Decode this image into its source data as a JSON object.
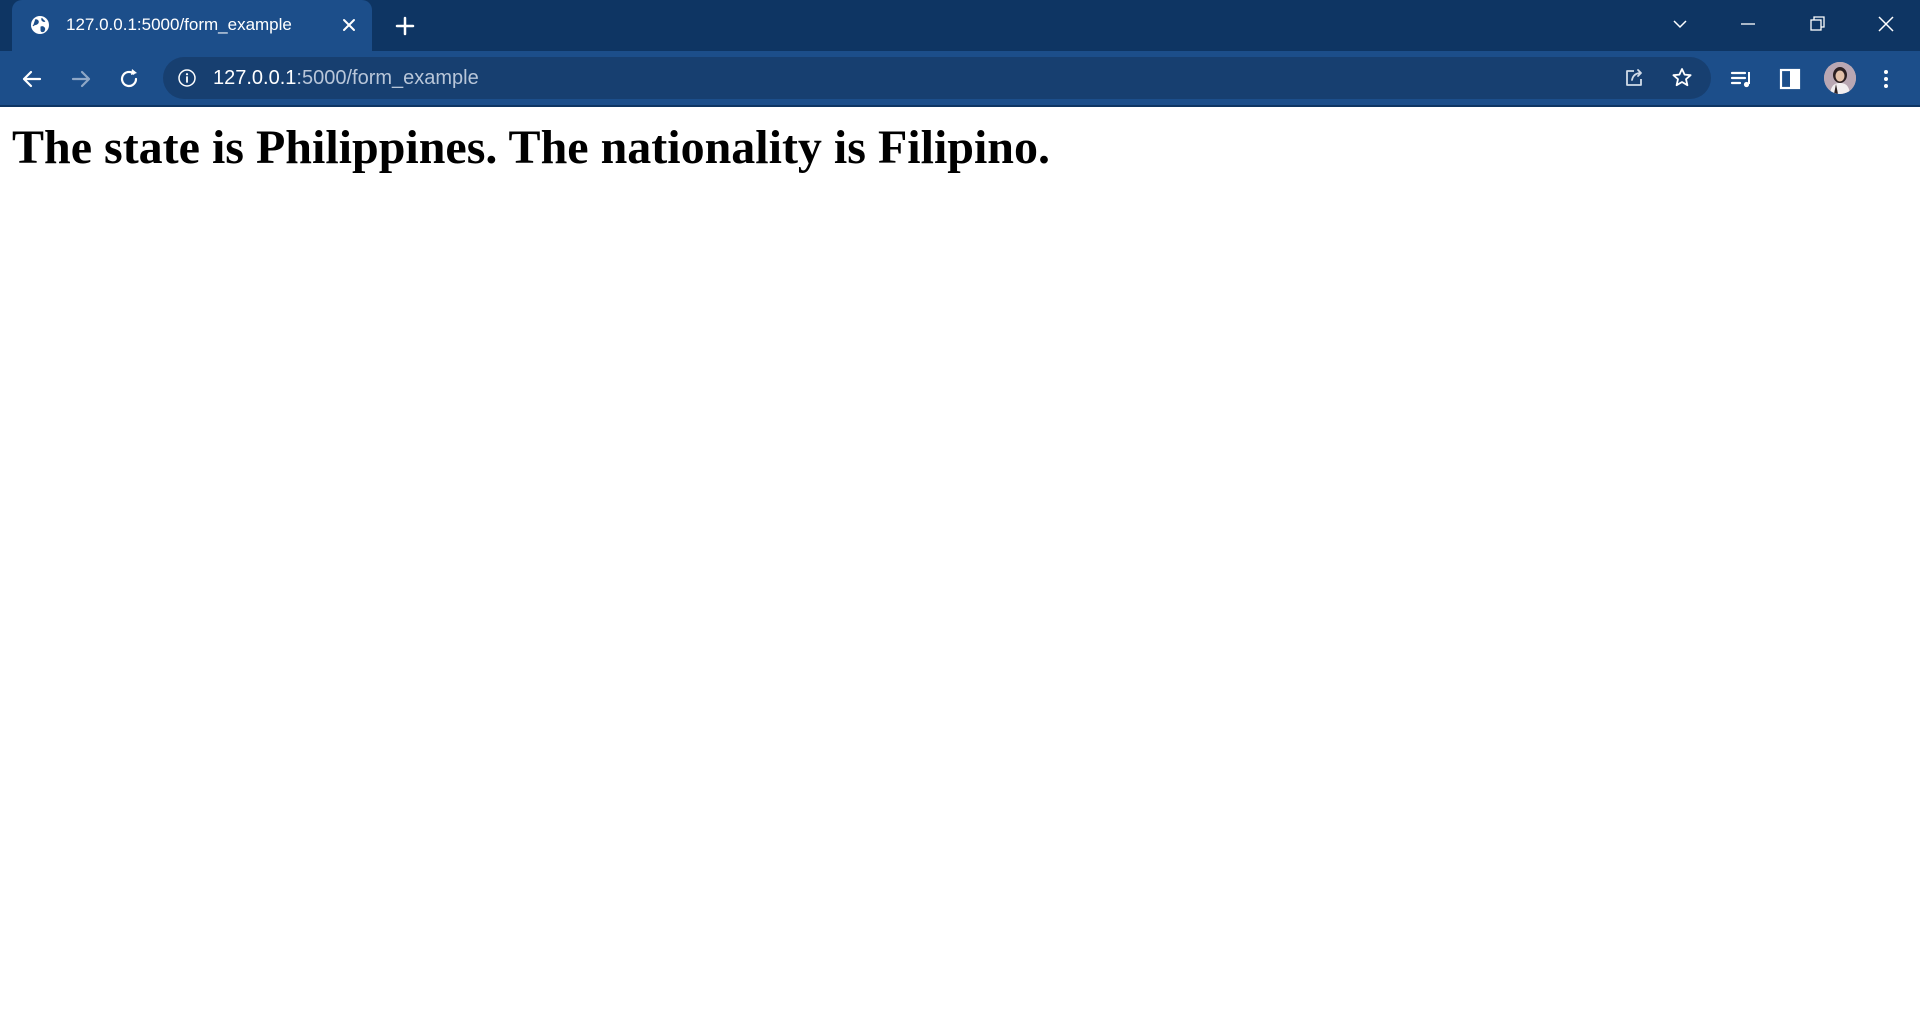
{
  "browser": {
    "tab": {
      "title": "127.0.0.1:5000/form_example",
      "favicon": "globe-icon"
    },
    "address_bar": {
      "host": "127.0.0.1",
      "path": ":5000/form_example"
    },
    "icons": {
      "tab_close": "close-icon",
      "new_tab": "plus-icon",
      "tab_search": "chevron-down-icon",
      "minimize": "minimize-icon",
      "restore": "restore-icon",
      "close_window": "close-icon",
      "back": "arrow-left-icon",
      "forward": "arrow-right-icon",
      "reload": "reload-icon",
      "site_info": "info-icon",
      "share": "share-icon",
      "bookmark": "star-icon",
      "media": "media-playlist-icon",
      "side_panel": "side-panel-icon",
      "profile": "avatar",
      "menu": "kebab-menu-icon"
    },
    "colors": {
      "tabstrip": "#0e3563",
      "toolbar": "#1c4e8a",
      "omnibox": "#173f70"
    }
  },
  "page": {
    "heading": "The state is Philippines. The nationality is Filipino."
  }
}
